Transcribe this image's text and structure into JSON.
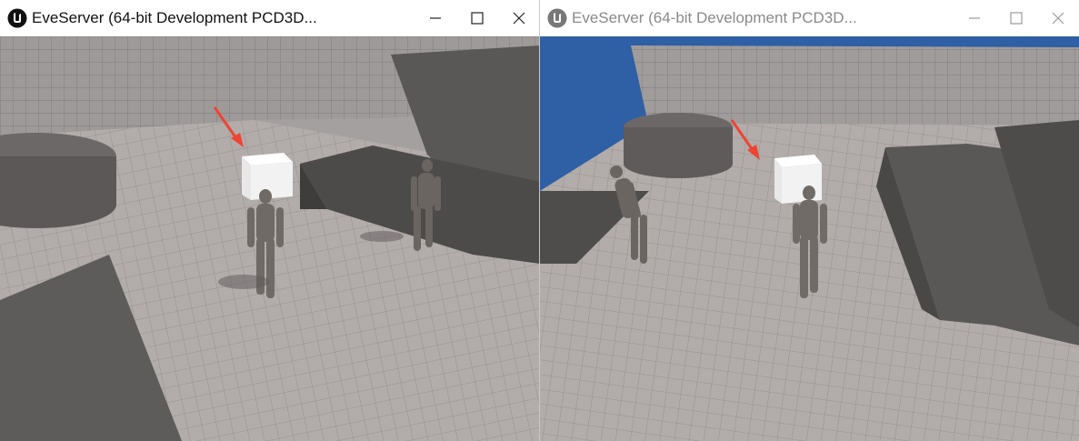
{
  "windows": [
    {
      "title": "EveServer (64-bit Development PCD3D...",
      "state": "active",
      "controls": {
        "minimize": "minimize-icon",
        "maximize": "maximize-icon",
        "close": "close-icon"
      }
    },
    {
      "title": "EveServer (64-bit Development PCD3D...",
      "state": "inactive",
      "controls": {
        "minimize": "minimize-icon",
        "maximize": "maximize-icon",
        "close": "close-icon"
      }
    }
  ],
  "colors": {
    "floor": "#b2acaa",
    "wall": "#5a5757",
    "sky": "#2f5fa4",
    "arrow": "#ee4433",
    "cube": "#f2f2f2"
  }
}
